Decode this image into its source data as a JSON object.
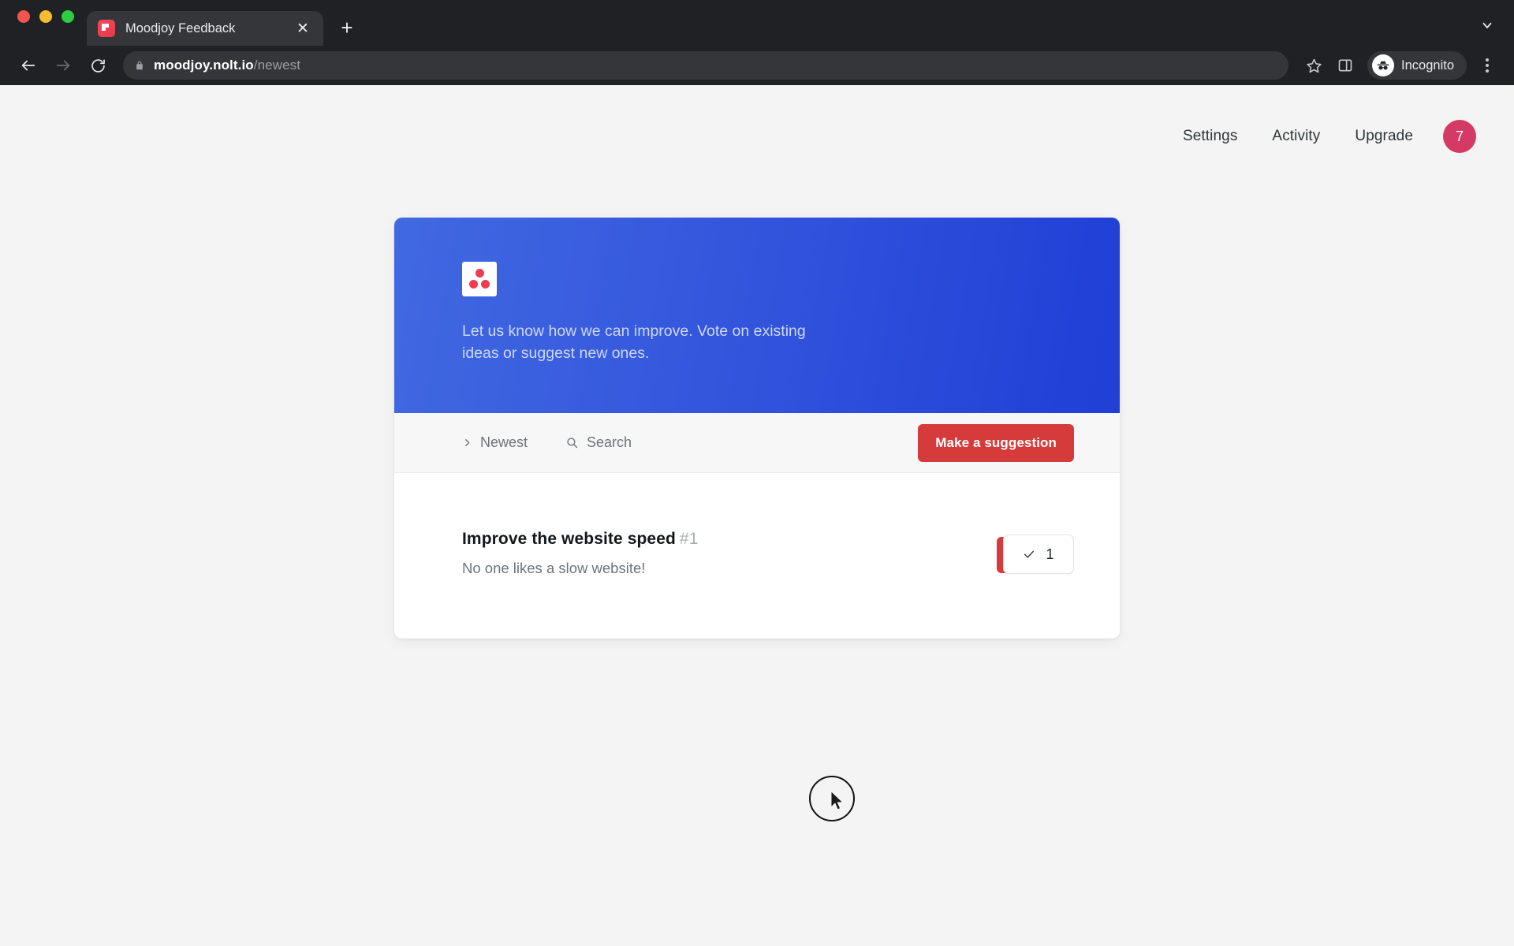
{
  "browser": {
    "tab": {
      "title": "Moodjoy Feedback",
      "favicon_name": "moodjoy-favicon",
      "close_label": "✕"
    },
    "new_tab_label": "+",
    "tabstrip_menu_icon": "chevron-down-icon",
    "nav": {
      "back_icon": "arrow-left-icon",
      "forward_icon": "arrow-right-icon",
      "reload_icon": "reload-icon"
    },
    "omnibox": {
      "lock_icon": "lock-icon",
      "url_domain": "moodjoy.nolt.io",
      "url_path": "/newest"
    },
    "bookmark_icon": "star-icon",
    "sidepanel_icon": "side-panel-icon",
    "incognito": {
      "label": "Incognito",
      "icon": "incognito-icon"
    },
    "menu_icon": "kebab-menu-icon",
    "colors": {
      "chrome_bg": "#202124",
      "tab_active": "#35363a",
      "omnibox_bg": "#35363a"
    }
  },
  "site": {
    "nav": {
      "items": [
        {
          "label": "Settings"
        },
        {
          "label": "Activity"
        },
        {
          "label": "Upgrade"
        }
      ],
      "avatar": {
        "label": "7",
        "color": "#d43a63"
      }
    },
    "board": {
      "hero": {
        "logo_name": "moodjoy-logo",
        "description": "Let us know how we can improve. Vote on existing ideas or suggest new ones.",
        "gradient_from": "#4169e1",
        "gradient_to": "#1f3fd6"
      },
      "toolbar": {
        "sort": {
          "label": "Newest",
          "icon": "chevron-right-icon"
        },
        "search": {
          "label": "Search",
          "icon": "search-icon"
        },
        "suggest_button": {
          "label": "Make a suggestion",
          "color": "#d63b3b"
        }
      },
      "posts": [
        {
          "title": "Improve the website speed",
          "number": "#1",
          "description": "No one likes a slow website!",
          "vote": {
            "count": "1",
            "icon": "check-icon",
            "voted": true,
            "accent_color": "#d63b3b"
          }
        }
      ]
    }
  },
  "cursor": {
    "indicator_name": "click-ring",
    "icon": "mouse-cursor-icon"
  }
}
